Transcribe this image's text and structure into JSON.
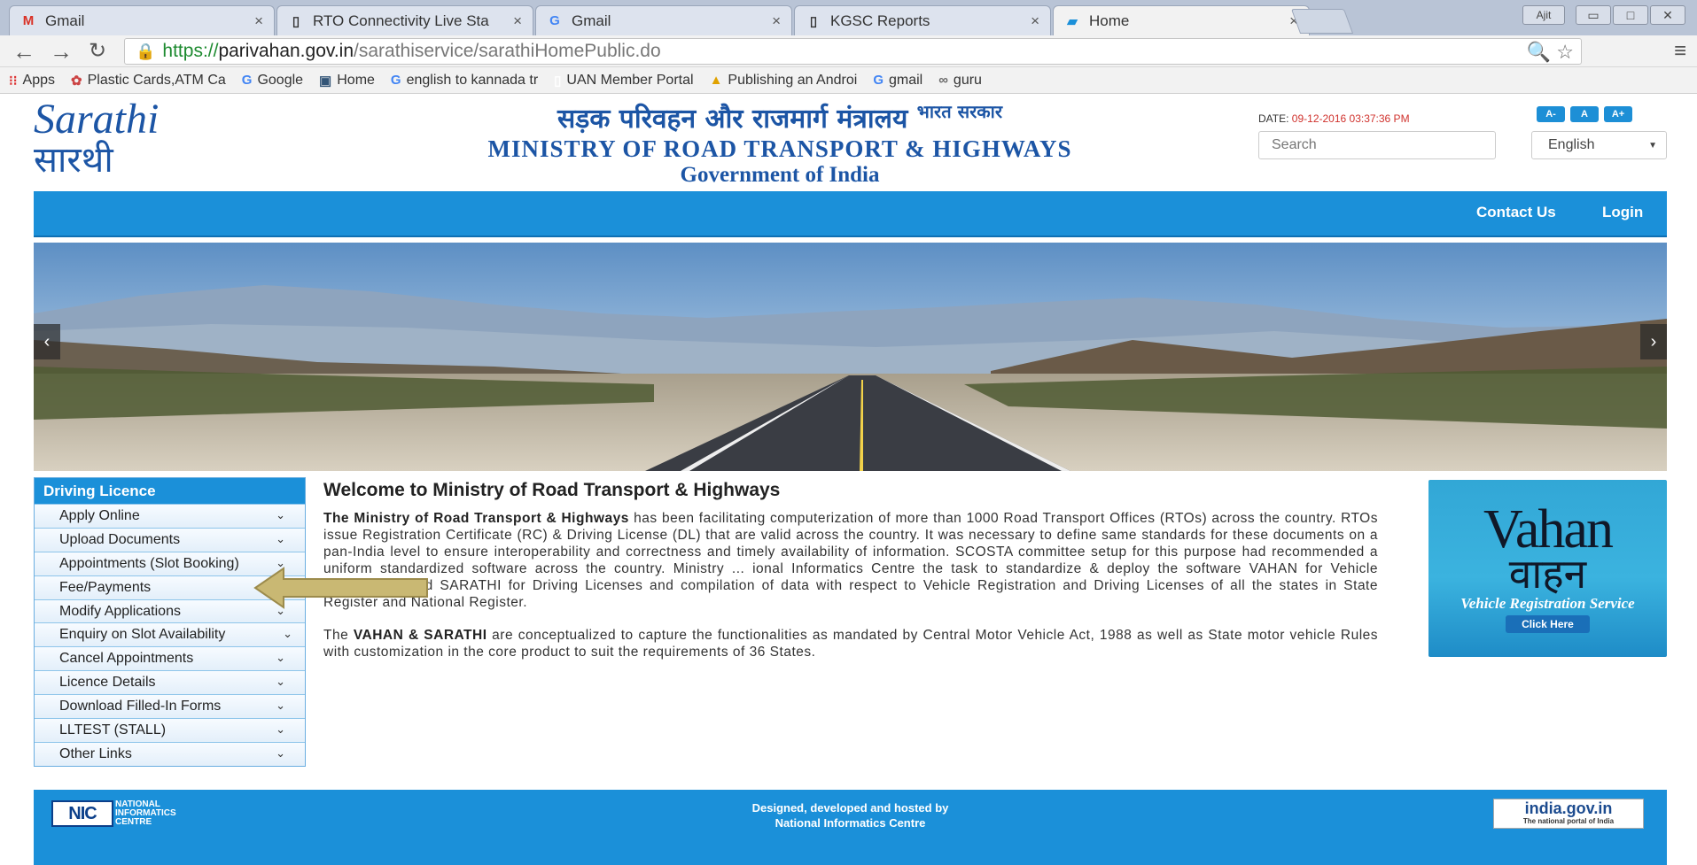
{
  "browser": {
    "tabs": [
      {
        "icon": "M",
        "title": "Gmail",
        "active": false
      },
      {
        "icon": "▯",
        "title": "RTO Connectivity Live Sta",
        "active": false
      },
      {
        "icon": "G",
        "title": "Gmail",
        "active": false
      },
      {
        "icon": "▯",
        "title": "KGSC Reports",
        "active": false
      },
      {
        "icon": "▰",
        "title": "Home",
        "active": true
      }
    ],
    "tab_close": "×",
    "window_controls": [
      "Ajit",
      "▭",
      "□",
      "✕"
    ],
    "url": {
      "scheme": "https://",
      "host": "parivahan.gov.in",
      "path": "/sarathiservice/sarathiHomePublic.do"
    },
    "bookmarks": [
      {
        "icon": "⁝⁝",
        "label": "Apps"
      },
      {
        "icon": "✿",
        "label": "Plastic Cards,ATM Ca"
      },
      {
        "icon": "G",
        "label": "Google"
      },
      {
        "icon": "▣",
        "label": "Home"
      },
      {
        "icon": "G",
        "label": "english to kannada tr"
      },
      {
        "icon": "▯",
        "label": "UAN Member Portal"
      },
      {
        "icon": "▲",
        "label": "Publishing an Androi"
      },
      {
        "icon": "G",
        "label": "gmail"
      },
      {
        "icon": "∞",
        "label": "guru"
      }
    ]
  },
  "header": {
    "logo_en": "Sarathi",
    "logo_hi": "सारथी",
    "hindi_title": "सड़क परिवहन और राजमार्ग मंत्रालय",
    "hindi_govt": "भारत सरकार",
    "ministry_en": "MINISTRY OF ROAD TRANSPORT & HIGHWAYS",
    "government": "Government of India",
    "date_label": "DATE:",
    "date_value": "09-12-2016 03:37:36 PM",
    "font_buttons": [
      "A-",
      "A",
      "A+"
    ],
    "search_placeholder": "Search",
    "language": "English"
  },
  "nav": {
    "contact": "Contact Us",
    "login": "Login"
  },
  "sidebar": {
    "heading": "Driving Licence",
    "items": [
      {
        "label": "Apply Online"
      },
      {
        "label": "Upload Documents"
      },
      {
        "label": "Appointments (Slot Booking)"
      },
      {
        "label": "Fee/Payments"
      },
      {
        "label": "Modify Applications"
      },
      {
        "label": "Enquiry on Slot Availability"
      },
      {
        "label": "Cancel Appointments"
      },
      {
        "label": "Licence Details"
      },
      {
        "label": "Download Filled-In Forms"
      },
      {
        "label": "LLTEST (STALL)"
      },
      {
        "label": "Other Links"
      }
    ]
  },
  "welcome": {
    "title": "Welcome to Ministry of Road Transport & Highways",
    "p1_bold": "The Ministry of Road Transport & Highways",
    "p1_rest": " has been facilitating computerization of more than 1000 Road Transport Offices (RTOs) across the country. RTOs issue Registration Certificate (RC) & Driving License (DL) that are valid across the country. It was necessary to define same standards for these documents on a pan-India level to ensure interoperability and correctness and timely availability of information. SCOSTA committee setup for this purpose had recommended a uniform standardized software across the country. Ministry ... ional Informatics Centre the task to standardize & deploy the software VAHAN for Vehicle Registration and SARATHI for Driving Licenses and compilation of data with respect to Vehicle Registration and Driving Licenses of all the states in State Register and National Register.",
    "p2_pre": "The ",
    "p2_bold": "VAHAN & SARATHI",
    "p2_rest": " are conceptualized to capture the functionalities as mandated by Central Motor Vehicle Act, 1988 as well as State motor vehicle Rules with customization in the core product to suit the requirements of 36 States."
  },
  "vahan": {
    "en": "Vahan",
    "hi": "वाहन",
    "subtitle": "Vehicle Registration Service",
    "button": "Click Here"
  },
  "footer": {
    "nic_logo": "NIC",
    "nic_text": "NATIONAL INFORMATICS CENTRE",
    "line1": "Designed, developed and hosted by",
    "line2": "National Informatics Centre",
    "india_gov": "india.gov.in",
    "india_gov_sub": "The national portal of India"
  },
  "colors": {
    "primary_blue": "#1b90d9",
    "title_blue": "#1c55a5",
    "date_red": "#d0322d",
    "annotation_arrow": "#c9b873"
  }
}
